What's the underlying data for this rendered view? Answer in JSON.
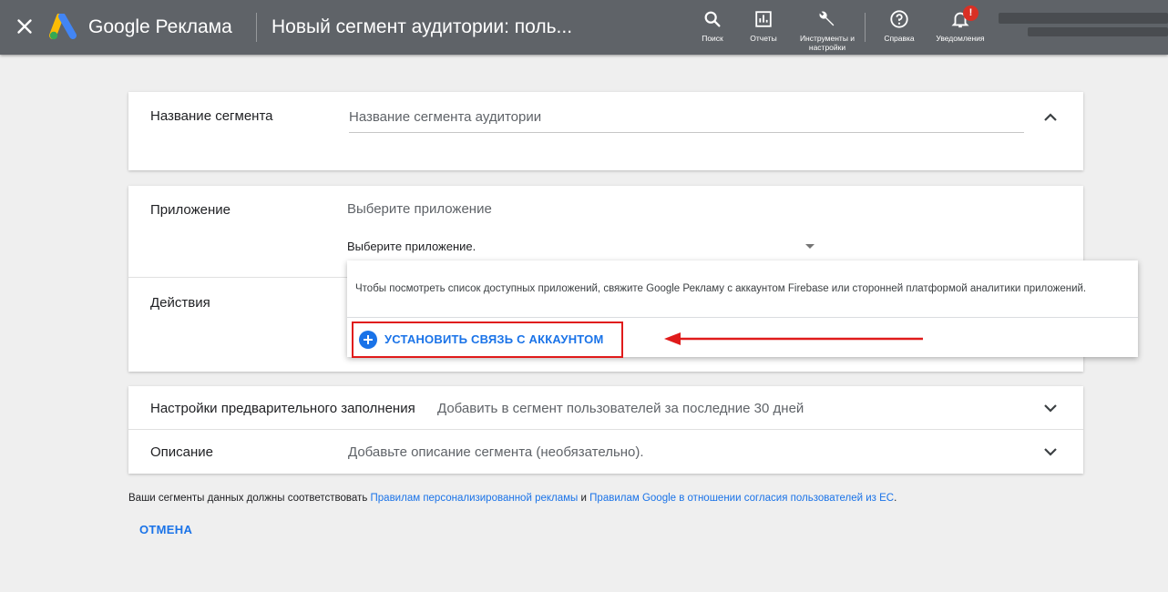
{
  "header": {
    "brand": "Google Реклама",
    "page_title": "Новый сегмент аудитории: поль...",
    "tools": [
      {
        "label": "Поиск",
        "icon": "search-icon"
      },
      {
        "label": "Отчеты",
        "icon": "reports-icon"
      },
      {
        "label": "Инструменты и настройки",
        "icon": "wrench-icon"
      },
      {
        "label": "Справка",
        "icon": "help-icon"
      },
      {
        "label": "Уведомления",
        "icon": "bell-icon",
        "badge": "!"
      }
    ]
  },
  "segment_name": {
    "label": "Название сегмента",
    "placeholder": "Название сегмента аудитории"
  },
  "app": {
    "label": "Приложение",
    "hint": "Выберите приложение",
    "select_value": "Выберите приложение.",
    "popup_message": "Чтобы посмотреть список доступных приложений, свяжите Google Рекламу с аккаунтом Firebase или сторонней платформой аналитики приложений.",
    "link_button": "УСТАНОВИТЬ СВЯЗЬ С АККАУНТОМ"
  },
  "actions": {
    "label": "Действия"
  },
  "prefill": {
    "label": "Настройки предварительного заполнения",
    "value": "Добавить в сегмент пользователей за последние 30 дней"
  },
  "description": {
    "label": "Описание",
    "placeholder": "Добавьте описание сегмента (необязательно)."
  },
  "footer": {
    "text_before": "Ваши сегменты данных должны соответствовать",
    "link1": "Правилам персонализированной рекламы",
    "conj": "и",
    "link2": "Правилам Google в отношении согласия пользователей из ЕС",
    "end": ".",
    "cancel": "ОТМЕНА"
  },
  "colors": {
    "header_bg": "#5f6368",
    "accent_blue": "#1a73e8",
    "highlight_red": "#e01b1b",
    "badge_red": "#d93025"
  }
}
